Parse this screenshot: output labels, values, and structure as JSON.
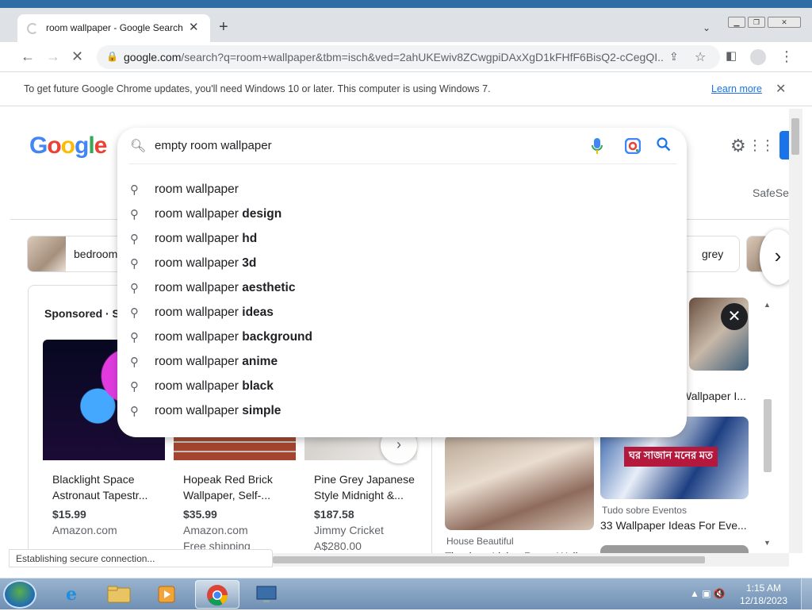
{
  "browser": {
    "tab_title": "room wallpaper - Google Search",
    "new_tab_label": "+",
    "url_host": "google.com",
    "url_path": "/search?q=room+wallpaper&tbm=isch&ved=2ahUKEwiv8ZCwgpiDAxXgD1kFHfF6BisQ2-cCegQI...",
    "infobar_message": "To get future Google Chrome updates, you'll need Windows 10 or later. This computer is using Windows 7.",
    "infobar_link": "Learn more",
    "status_text": "Establishing secure connection..."
  },
  "search": {
    "query": "empty room wallpaper",
    "suggestions": [
      {
        "base": "room wallpaper",
        "bold": ""
      },
      {
        "base": "room wallpaper ",
        "bold": "design"
      },
      {
        "base": "room wallpaper ",
        "bold": "hd"
      },
      {
        "base": "room wallpaper ",
        "bold": "3d"
      },
      {
        "base": "room wallpaper ",
        "bold": "aesthetic"
      },
      {
        "base": "room wallpaper ",
        "bold": "ideas"
      },
      {
        "base": "room wallpaper ",
        "bold": "background"
      },
      {
        "base": "room wallpaper ",
        "bold": "anime"
      },
      {
        "base": "room wallpaper ",
        "bold": "black"
      },
      {
        "base": "room wallpaper ",
        "bold": "simple"
      }
    ]
  },
  "page": {
    "logo_letters": [
      "G",
      "o",
      "o",
      "g",
      "l",
      "e"
    ],
    "logo_colors": [
      "#4285f4",
      "#ea4335",
      "#fbbc05",
      "#4285f4",
      "#34a853",
      "#ea4335"
    ],
    "safesearch": "SafeSe",
    "chips": [
      "bedroom",
      "grey"
    ],
    "sponsored_label": "Sponsored · S",
    "products": [
      {
        "name": "Blacklight Space Astronaut Tapestr...",
        "price": "$15.99",
        "store": "Amazon.com",
        "extra": ""
      },
      {
        "name": "Hopeak Red Brick Wallpaper, Self-...",
        "price": "$35.99",
        "store": "Amazon.com",
        "extra": "Free shipping"
      },
      {
        "name": "Pine Grey Japanese Style Midnight &...",
        "price": "$187.58",
        "store": "Jimmy Cricket",
        "extra": "A$280.00"
      }
    ],
    "results": [
      {
        "source": "House Beautiful",
        "title": "Timeless Living Room Wall..."
      },
      {
        "source": "Tudo sobre Eventos",
        "title": "33 Wallpaper Ideas For Eve..."
      },
      {
        "source": "",
        "title": "Wallpaper I..."
      }
    ],
    "bengali_banner": "ঘর সাজান মনের মত"
  },
  "taskbar": {
    "time": "1:15 AM",
    "date": "12/18/2023"
  },
  "colors": {
    "accent": "#1a73e8",
    "taskbar": "#6f8fb3"
  }
}
